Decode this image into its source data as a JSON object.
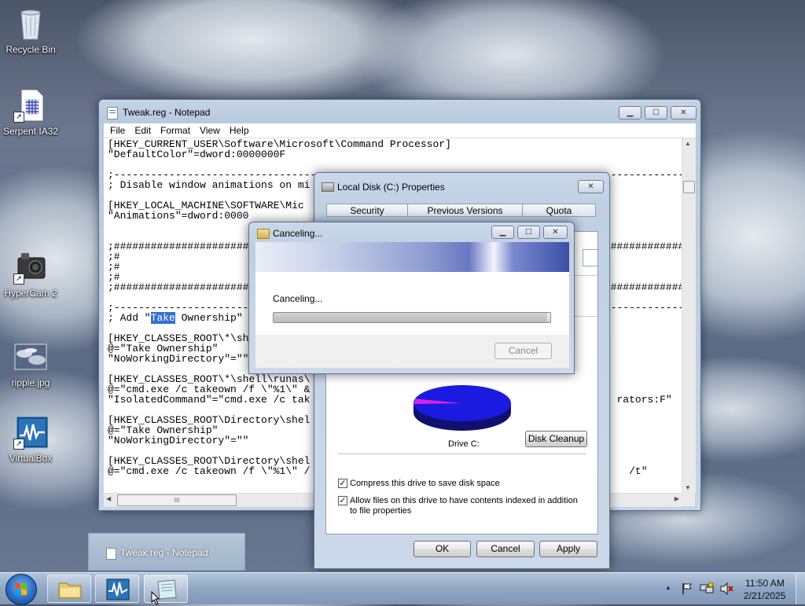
{
  "desktop": {
    "icons": [
      {
        "label": "Recycle Bin",
        "icon": "recycle-bin-icon"
      },
      {
        "label": "Serpent IA32",
        "icon": "serpent-ia32-icon"
      },
      {
        "label": "HyperCam 2",
        "icon": "hypercam-icon"
      },
      {
        "label": "ripple.jpg",
        "icon": "image-file-icon"
      },
      {
        "label": "VirtualBox",
        "icon": "virtualbox-icon"
      }
    ]
  },
  "notepad": {
    "title": "Tweak.reg - Notepad",
    "menu": [
      "File",
      "Edit",
      "Format",
      "View",
      "Help"
    ],
    "lines": [
      "[HKEY_CURRENT_USER\\Software\\Microsoft\\Command Processor]",
      "\"DefaultColor\"=dword:0000000F",
      "",
      ";-----------------------------------------------------------------------------------------------------------",
      "; Disable window animations on mi",
      "",
      "[HKEY_LOCAL_MACHINE\\SOFTWARE\\Mic",
      "\"Animations\"=dword:0000",
      "",
      "",
      ";##############################################################################################################",
      ";#",
      ";#",
      ";#",
      ";##############################################################################################################",
      "",
      ";-----------------------------------------------------------------------------------------------------------",
      "__TAKE__",
      "",
      "[HKEY_CLASSES_ROOT\\*\\sh",
      "@=\"Take Ownership\"",
      "\"NoWorkingDirectory\"=\"\"",
      "",
      "[HKEY_CLASSES_ROOT\\*\\shell\\runas\\",
      "@=\"cmd.exe /c takeown /f \\\"%1\\\" &",
      "\"IsolatedCommand\"=\"cmd.exe /c tak                                                  rators:F\"",
      "",
      "[HKEY_CLASSES_ROOT\\Directory\\shel",
      "@=\"Take Ownership\"",
      "\"NoWorkingDirectory\"=\"\"",
      "",
      "[HKEY_CLASSES_ROOT\\Directory\\shel",
      "@=\"cmd.exe /c takeown /f \\\"%1\\\" /                                                    /t\""
    ],
    "take_line": {
      "before": "; Add \"",
      "highlight": "Take",
      "after": " Ownership\""
    },
    "hscroll_thumb": "III",
    "controls": {
      "minimize": "▁",
      "maximize": "☐",
      "close": "✕"
    }
  },
  "properties": {
    "title": "Local Disk (C:) Properties",
    "tabs": [
      "Security",
      "Previous Versions",
      "Quota"
    ],
    "drive_label": "Drive C:",
    "disk_cleanup": "Disk Cleanup",
    "pie": {
      "used_fraction": 0.04,
      "used_color": "#e020e0",
      "free_color": "#1a1ae0"
    },
    "compress_label": "Compress this drive to save disk space",
    "index_label": "Allow files on this drive to have contents indexed in addition to file properties",
    "compress_checked": true,
    "index_checked": true,
    "buttons": {
      "ok": "OK",
      "cancel": "Cancel",
      "apply": "Apply"
    },
    "close": "✕"
  },
  "canceling": {
    "title": "Canceling...",
    "message": "Canceling...",
    "progress": 0.99,
    "cancel_button": "Cancel",
    "controls": {
      "minimize": "▁",
      "maximize": "☐",
      "close": "✕"
    }
  },
  "taskbar": {
    "thumbnail_label": "Tweak.reg - Notepad",
    "time": "11:50 AM",
    "date": "2/21/2025",
    "tray_up": "▲"
  }
}
